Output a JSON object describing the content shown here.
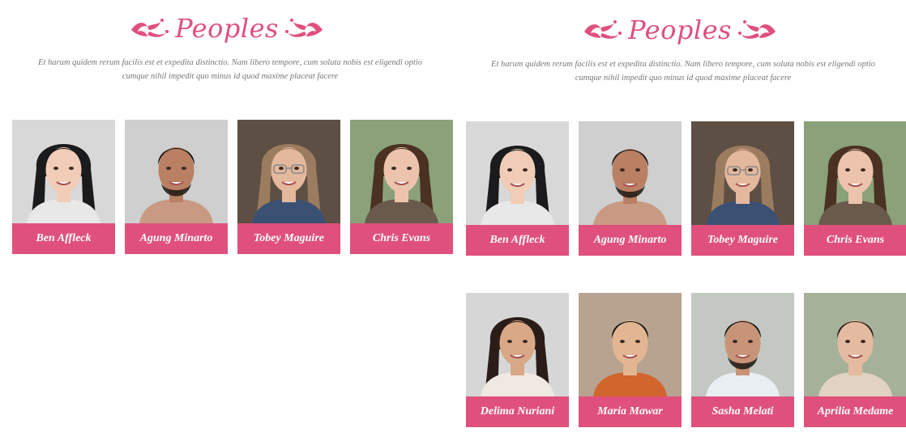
{
  "colors": {
    "accent": "#e0507d",
    "text_muted": "#777777"
  },
  "sections": [
    {
      "title": "Peoples",
      "description_line1": "Et harum quidem rerum facilis est et expedita distinctio. Nam libero tempore, cum soluta nobis est eligendi optio",
      "description_line2": "cumque nihil impedit quo minus id quod maxime placeat facere",
      "people": [
        {
          "name": "Ben Affleck",
          "photo": "woman-long-black-hair-photo"
        },
        {
          "name": "Agung Minarto",
          "photo": "bearded-man-photo"
        },
        {
          "name": "Tobey Maguire",
          "photo": "older-woman-glasses-photo"
        },
        {
          "name": "Chris Evans",
          "photo": "smiling-woman-photo"
        }
      ]
    },
    {
      "title": "Peoples",
      "description_line1": "Et harum quidem rerum facilis est et expedita distinctio. Nam libero tempore, cum soluta nobis est eligendi optio",
      "description_line2": "cumque nihil impedit quo minus id quod maxime placeat facere",
      "people": [
        {
          "name": "Ben Affleck",
          "photo": "woman-long-black-hair-photo"
        },
        {
          "name": "Agung Minarto",
          "photo": "bearded-man-photo"
        },
        {
          "name": "Tobey Maguire",
          "photo": "older-woman-glasses-photo"
        },
        {
          "name": "Chris Evans",
          "photo": "smiling-woman-photo"
        },
        {
          "name": "Delima Nuriani",
          "photo": "woman-dark-hair-photo"
        },
        {
          "name": "Maria Mawar",
          "photo": "young-man-black-hair-photo"
        },
        {
          "name": "Sasha Melati",
          "photo": "smiling-man-photo"
        },
        {
          "name": "Aprilia Medame",
          "photo": "young-person-curly-hair-photo"
        }
      ]
    }
  ]
}
